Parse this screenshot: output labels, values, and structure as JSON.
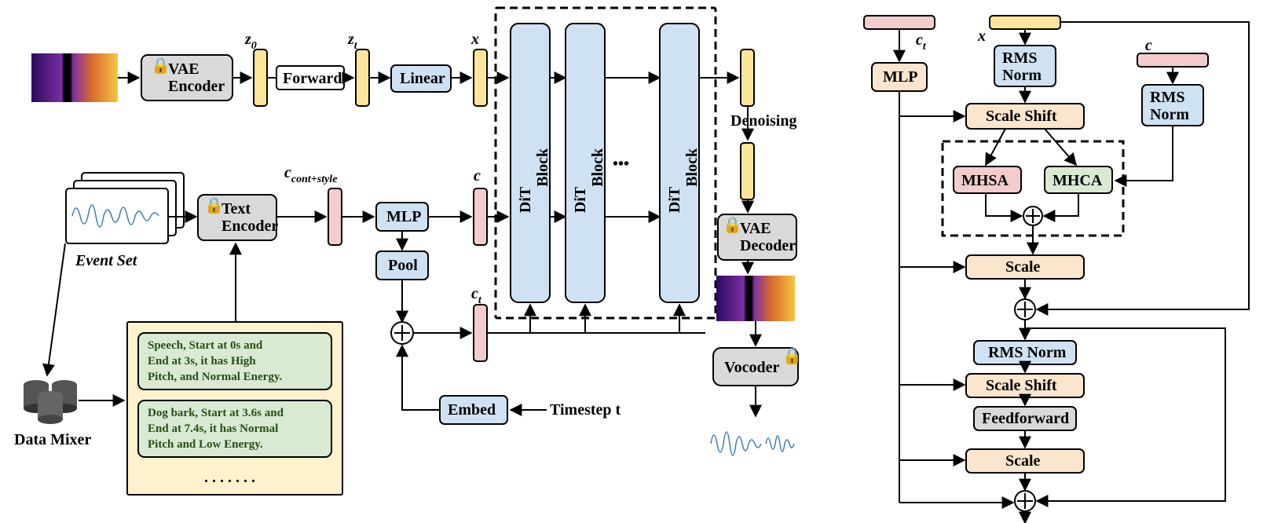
{
  "left": {
    "vae_enc": "VAE\nEncoder",
    "forward": "Forward",
    "linear": "Linear",
    "z0": "z",
    "z0_sub": "0",
    "zt": "z",
    "zt_sub": "t",
    "x": "x",
    "text_enc": "Text\nEncoder",
    "mlp": "MLP",
    "pool": "Pool",
    "embed": "Embed",
    "ccont": "c",
    "ccont_sub": "cont+style",
    "c": "c",
    "ct": "c",
    "ct_sub": "t",
    "dit": "DiT\nBlock",
    "vae_dec": "VAE\nDecoder",
    "denoise": "Denoising",
    "vocoder": "Vocoder",
    "timestep": "Timestep t",
    "event_set": "Event Set",
    "data_mixer": "Data Mixer",
    "prompt1_l1": "Speech, Start at 0s and",
    "prompt1_l2": "End at 3s, it has High",
    "prompt1_l3": "Pitch, and Normal Energy.",
    "prompt2_l1": "Dog bark, Start at 3.6s and",
    "prompt2_l2": "End at 7.4s, it has Normal",
    "prompt2_l3": "Pitch and Low Energy.",
    "dots": ". . . . . . ."
  },
  "right": {
    "mlp": "MLP",
    "ct": "c",
    "ct_sub": "t",
    "x": "x",
    "c": "c",
    "rms": "RMS\nNorm",
    "rms1l": "RMS Norm",
    "scale_shift": "Scale Shift",
    "mhsa": "MHSA",
    "mhca": "MHCA",
    "scale": "Scale",
    "ff": "Feedforward"
  }
}
